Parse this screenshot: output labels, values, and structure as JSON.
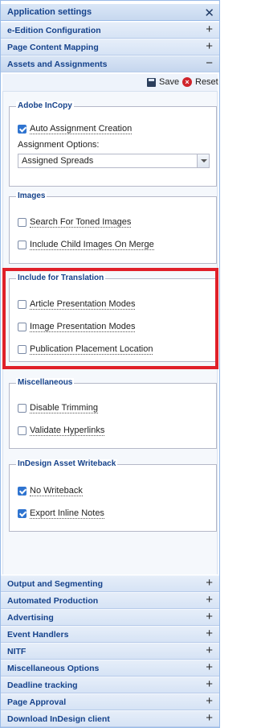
{
  "panel": {
    "title": "Application settings"
  },
  "sections_top": [
    {
      "label": "e-Edition Configuration",
      "symbol": "+"
    },
    {
      "label": "Page Content Mapping",
      "symbol": "+"
    },
    {
      "label": "Assets and Assignments",
      "symbol": "−"
    }
  ],
  "toolbar": {
    "save_label": "Save",
    "reset_label": "Reset"
  },
  "adobe_incopy": {
    "legend": "Adobe InCopy",
    "auto_assignment": {
      "label": "Auto Assignment Creation",
      "checked": true
    },
    "assignment_options_label": "Assignment Options:",
    "assignment_options_value": "Assigned Spreads"
  },
  "images": {
    "legend": "Images",
    "items": [
      {
        "label": "Search For Toned Images",
        "checked": false
      },
      {
        "label": "Include Child Images On Merge",
        "checked": false
      }
    ]
  },
  "translation": {
    "legend": "Include for Translation",
    "items": [
      {
        "label": "Article Presentation Modes",
        "checked": false
      },
      {
        "label": "Image Presentation Modes",
        "checked": false
      },
      {
        "label": "Publication Placement Location",
        "checked": false
      }
    ]
  },
  "misc": {
    "legend": "Miscellaneous",
    "items": [
      {
        "label": "Disable Trimming",
        "checked": false
      },
      {
        "label": "Validate Hyperlinks",
        "checked": false
      }
    ]
  },
  "writeback": {
    "legend": "InDesign Asset Writeback",
    "items": [
      {
        "label": "No Writeback",
        "checked": true
      },
      {
        "label": "Export Inline Notes",
        "checked": true
      }
    ]
  },
  "sections_bottom": [
    {
      "label": "Output and Segmenting",
      "symbol": "+"
    },
    {
      "label": "Automated Production",
      "symbol": "+"
    },
    {
      "label": "Advertising",
      "symbol": "+"
    },
    {
      "label": "Event Handlers",
      "symbol": "+"
    },
    {
      "label": "NITF",
      "symbol": "+"
    },
    {
      "label": "Miscellaneous Options",
      "symbol": "+"
    },
    {
      "label": "Deadline tracking",
      "symbol": "+"
    },
    {
      "label": "Page Approval",
      "symbol": "+"
    },
    {
      "label": "Download InDesign client",
      "symbol": "+"
    }
  ],
  "colors": {
    "highlight": "#e0202a",
    "header_text": "#15428b",
    "checkbox_on": "#2f74d0"
  }
}
